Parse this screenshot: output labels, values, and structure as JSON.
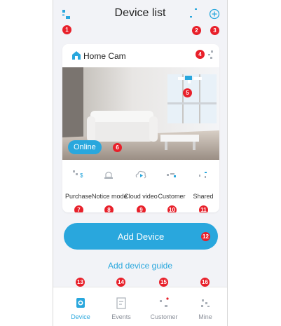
{
  "header": {
    "title": "Device list",
    "badges": [
      "1",
      "2",
      "3"
    ]
  },
  "device": {
    "name": "Home Cam",
    "status": "Online",
    "badges": [
      "4",
      "5",
      "6"
    ]
  },
  "features": [
    {
      "label": "Purchase",
      "badge": "7",
      "icon": "purchase-icon"
    },
    {
      "label": "Notice mode",
      "badge": "8",
      "icon": "notice-mode-icon"
    },
    {
      "label": "Cloud video",
      "badge": "9",
      "icon": "cloud-video-icon"
    },
    {
      "label": "Customer",
      "badge": "10",
      "icon": "customer-service-icon"
    },
    {
      "label": "Shared",
      "badge": "11",
      "icon": "share-icon"
    }
  ],
  "add_device": {
    "label": "Add Device",
    "badge": "12"
  },
  "guide": {
    "label": "Add device guide"
  },
  "tabs": [
    {
      "label": "Device",
      "badge": "13",
      "icon": "device-icon"
    },
    {
      "label": "Events",
      "badge": "14",
      "icon": "events-icon"
    },
    {
      "label": "Customer",
      "badge": "15",
      "icon": "customer-icon"
    },
    {
      "label": "Mine",
      "badge": "16",
      "icon": "mine-icon"
    }
  ],
  "colors": {
    "accent": "#29a7dd",
    "badge": "#e8202a",
    "background": "#f2f3f7",
    "tab_inactive": "#8a8f99"
  }
}
